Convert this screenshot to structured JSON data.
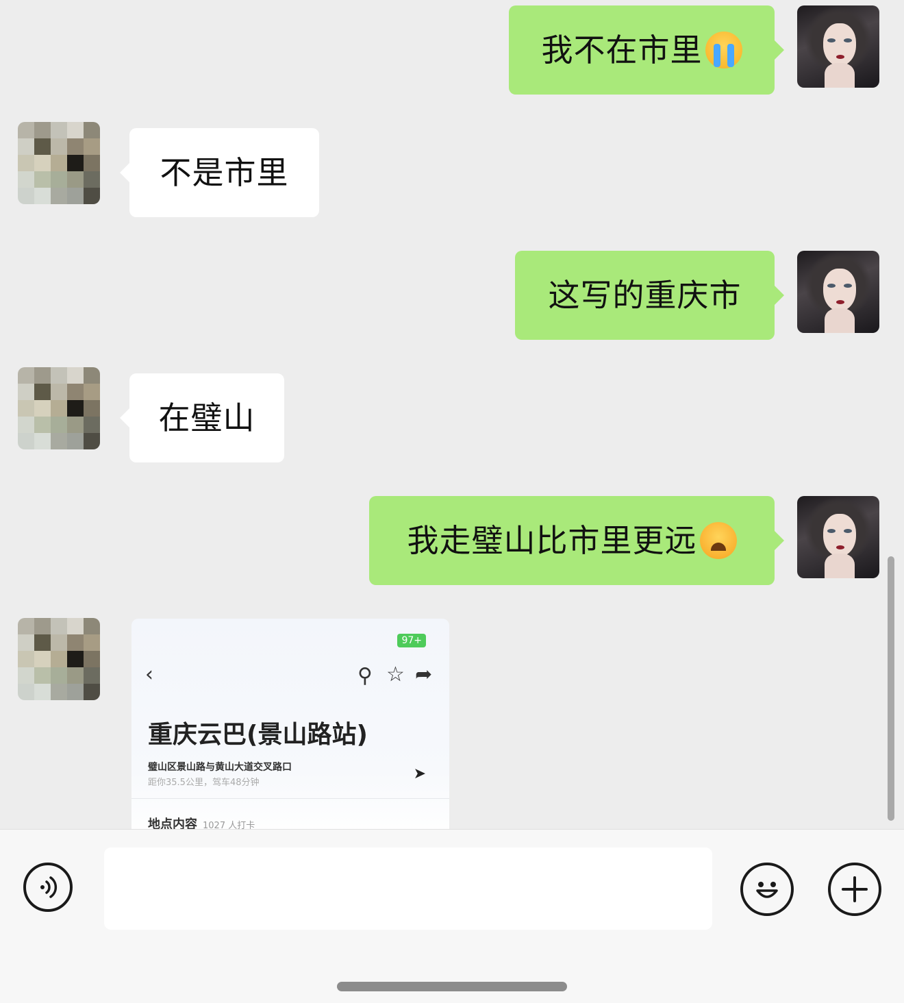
{
  "messages": [
    {
      "sender": "me",
      "text": "我不在市里",
      "emoji": "loudly-crying-face"
    },
    {
      "sender": "other",
      "text": "不是市里"
    },
    {
      "sender": "me",
      "text": "这写的重庆市"
    },
    {
      "sender": "other",
      "text": "在璧山"
    },
    {
      "sender": "me",
      "text": "我走璧山比市里更远",
      "emoji": "persevering-face"
    },
    {
      "sender": "other",
      "type": "shared-location-card"
    }
  ],
  "card": {
    "battery": "97+",
    "back_icon": "chevron-left-icon",
    "search_icon": "search-icon",
    "star_icon": "star-icon",
    "share_icon": "share-icon",
    "title": "重庆云巴(景山路站)",
    "address": "璧山区景山路与黄山大道交叉路口",
    "distance": "距你35.5公里，驾车48分钟",
    "section_label": "地点内容",
    "checkin_count": "1027 人打卡"
  },
  "input_bar": {
    "voice_icon": "voice-icon",
    "emoji_icon": "emoji-icon",
    "plus_icon": "plus-icon",
    "text_value": ""
  },
  "colors": {
    "background": "#ededed",
    "my_bubble": "#a9e97a",
    "other_bubble": "#ffffff"
  }
}
